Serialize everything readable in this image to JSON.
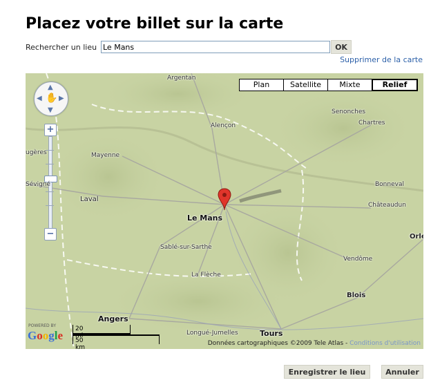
{
  "page": {
    "title": "Placez votre billet sur la carte"
  },
  "search": {
    "label": "Rechercher un lieu",
    "value": "Le Mans",
    "ok_label": "OK",
    "clear_link": "Supprimer de la carte"
  },
  "map": {
    "map_types": [
      {
        "label": "Plan",
        "active": false
      },
      {
        "label": "Satellite",
        "active": false
      },
      {
        "label": "Mixte",
        "active": false
      },
      {
        "label": "Relief",
        "active": true
      }
    ],
    "controls": {
      "zoom_in": "+",
      "zoom_out": "−",
      "pan_icon": "hand-icon"
    },
    "places": {
      "argentan": "Argentan",
      "senonches": "Senonches",
      "chartres": "Chartres",
      "alencon": "Alençon",
      "fougeres": "ugères",
      "mayenne": "Mayenne",
      "sevigne": "Sévigné",
      "bonneval": "Bonneval",
      "laval": "Laval",
      "chateaudun": "Châteaudun",
      "le_mans": "Le Mans",
      "orleans": "Orlé",
      "sable": "Sablé-sur-Sarthe",
      "vendome": "Vendôme",
      "la_fleche": "La Flèche",
      "blois": "Blois",
      "angers": "Angers",
      "longue": "Longué-Jumelles",
      "tours": "Tours"
    },
    "scale": {
      "miles": "20 mi",
      "km": "50 km"
    },
    "powered_by": "POWERED BY",
    "logo": "Google",
    "logo_colors": [
      "#3b6fd6",
      "#d93025",
      "#f2b400",
      "#3b6fd6",
      "#1e9e4a",
      "#d93025"
    ],
    "attribution": "Données cartographiques ©2009 Tele Atlas - ",
    "terms_link": "Conditions d'utilisation",
    "marker_color": "#e0352b"
  },
  "actions": {
    "save_label": "Enregistrer le lieu",
    "cancel_label": "Annuler"
  }
}
